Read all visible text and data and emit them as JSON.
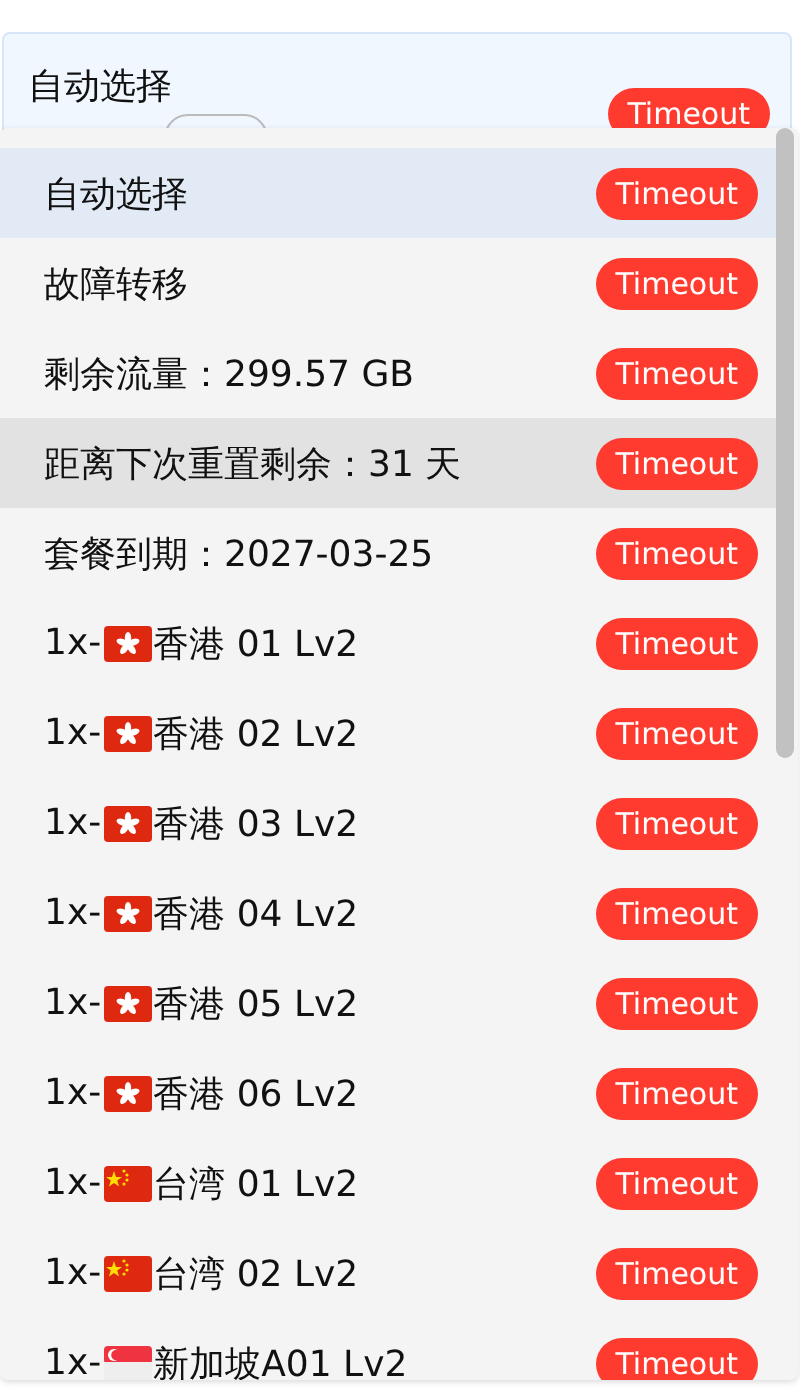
{
  "header": {
    "title": "自动选择",
    "badge": "Timeout"
  },
  "items": [
    {
      "kind": "none",
      "name": "自动选择",
      "badge": "Timeout",
      "selected": true,
      "hovered": false
    },
    {
      "kind": "none",
      "name": "故障转移",
      "badge": "Timeout",
      "selected": false,
      "hovered": false
    },
    {
      "kind": "none",
      "name": "剩余流量：299.57 GB",
      "badge": "Timeout",
      "selected": false,
      "hovered": false
    },
    {
      "kind": "none",
      "name": "距离下次重置剩余：31 天",
      "badge": "Timeout",
      "selected": false,
      "hovered": true
    },
    {
      "kind": "none",
      "name": "套餐到期：2027-03-25",
      "badge": "Timeout",
      "selected": false,
      "hovered": false
    },
    {
      "prefix": "1x-",
      "kind": "hongkong",
      "name": "香港 01 Lv2",
      "badge": "Timeout",
      "selected": false,
      "hovered": false
    },
    {
      "prefix": "1x-",
      "kind": "hongkong",
      "name": "香港 02 Lv2",
      "badge": "Timeout",
      "selected": false,
      "hovered": false
    },
    {
      "prefix": "1x-",
      "kind": "hongkong",
      "name": "香港 03 Lv2",
      "badge": "Timeout",
      "selected": false,
      "hovered": false
    },
    {
      "prefix": "1x-",
      "kind": "hongkong",
      "name": "香港 04 Lv2",
      "badge": "Timeout",
      "selected": false,
      "hovered": false
    },
    {
      "prefix": "1x-",
      "kind": "hongkong",
      "name": "香港 05 Lv2",
      "badge": "Timeout",
      "selected": false,
      "hovered": false
    },
    {
      "prefix": "1x-",
      "kind": "hongkong",
      "name": "香港 06 Lv2",
      "badge": "Timeout",
      "selected": false,
      "hovered": false
    },
    {
      "prefix": "1x-",
      "kind": "china",
      "name": "台湾 01 Lv2",
      "badge": "Timeout",
      "selected": false,
      "hovered": false
    },
    {
      "prefix": "1x-",
      "kind": "china",
      "name": "台湾 02 Lv2",
      "badge": "Timeout",
      "selected": false,
      "hovered": false
    },
    {
      "prefix": "1x-",
      "kind": "singapore",
      "name": "新加坡A01 Lv2",
      "badge": "Timeout",
      "selected": false,
      "hovered": false
    }
  ]
}
